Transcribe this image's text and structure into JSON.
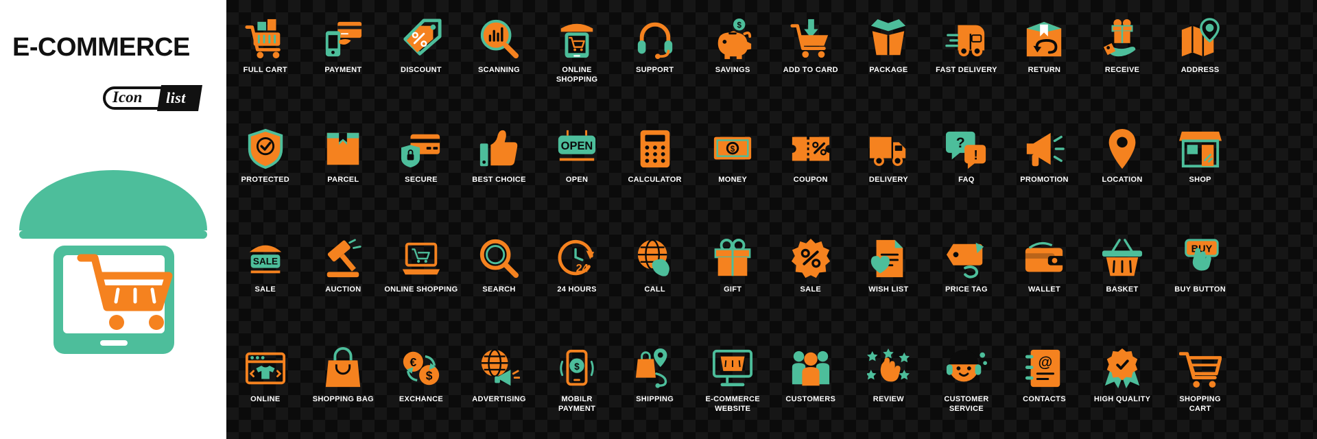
{
  "left": {
    "title": "E-COMMERCE",
    "logo": {
      "word_icon": "Icon",
      "word_list": "list"
    },
    "hero_icon_name": "online-store-mobile-cart-illustration"
  },
  "colors": {
    "orange": "#F5821F",
    "teal": "#4DBE9B",
    "dark_bg": "#0b0b0b",
    "checker": "#161616",
    "label": "#FFFFFF",
    "title": "#111111"
  },
  "grid": {
    "columns": 14,
    "rows": 4,
    "icons": [
      {
        "label": "FULL CART",
        "icon": "full-cart-icon"
      },
      {
        "label": "PAYMENT",
        "icon": "payment-card-hand-icon"
      },
      {
        "label": "DISCOUNT",
        "icon": "discount-tag-icon"
      },
      {
        "label": "SCANNING",
        "icon": "magnifier-chart-icon"
      },
      {
        "label": "ONLINE\nSHOPPING",
        "icon": "online-shopping-mobile-store-icon"
      },
      {
        "label": "SUPPORT",
        "icon": "headset-support-icon"
      },
      {
        "label": "SAVINGS",
        "icon": "piggy-bank-icon"
      },
      {
        "label": "ADD TO CARD",
        "icon": "add-to-cart-arrow-icon"
      },
      {
        "label": "PACKAGE",
        "icon": "open-box-package-icon"
      },
      {
        "label": "FAST DELIVERY",
        "icon": "fast-delivery-truck-icon"
      },
      {
        "label": "RETURN",
        "icon": "return-box-arrow-icon"
      },
      {
        "label": "RECEIVE",
        "icon": "receive-gift-hand-icon"
      },
      {
        "label": "ADDRESS",
        "icon": "map-pin-address-icon"
      },
      {
        "label": "PROTECTED",
        "icon": "shield-check-icon"
      },
      {
        "label": "PARCEL",
        "icon": "parcel-box-icon"
      },
      {
        "label": "SECURE",
        "icon": "secure-card-lock-icon"
      },
      {
        "label": "BEST CHOICE",
        "icon": "thumbs-up-icon"
      },
      {
        "label": "OPEN",
        "icon": "open-sign-icon"
      },
      {
        "label": "CALCULATOR",
        "icon": "calculator-icon"
      },
      {
        "label": "MONEY",
        "icon": "banknote-money-icon"
      },
      {
        "label": "COUPON",
        "icon": "coupon-percent-icon"
      },
      {
        "label": "DELIVERY",
        "icon": "delivery-van-icon"
      },
      {
        "label": "FAQ",
        "icon": "faq-question-bubble-icon"
      },
      {
        "label": "PROMOTION",
        "icon": "megaphone-promotion-icon"
      },
      {
        "label": "LOCATION",
        "icon": "location-pin-icon"
      },
      {
        "label": "SHOP",
        "icon": "shop-storefront-icon"
      },
      {
        "label": "SALE",
        "icon": "sale-tag-icon"
      },
      {
        "label": "AUCTION",
        "icon": "auction-gavel-icon"
      },
      {
        "label": "ONLINE SHOPPING",
        "icon": "laptop-cart-icon"
      },
      {
        "label": "SEARCH",
        "icon": "search-magnifier-icon"
      },
      {
        "label": "24 HOURS",
        "icon": "24-hours-clock-icon"
      },
      {
        "label": "CALL",
        "icon": "global-call-icon"
      },
      {
        "label": "GIFT",
        "icon": "gift-box-icon"
      },
      {
        "label": "SALE",
        "icon": "sale-percent-badge-icon"
      },
      {
        "label": "WISH LIST",
        "icon": "wish-list-heart-document-icon"
      },
      {
        "label": "PRICE TAG",
        "icon": "price-tag-icon"
      },
      {
        "label": "WALLET",
        "icon": "wallet-icon"
      },
      {
        "label": "BASKET",
        "icon": "shopping-basket-icon"
      },
      {
        "label": "BUY BUTTON",
        "icon": "buy-button-click-icon"
      },
      {
        "label": "ONLINE",
        "icon": "online-browser-tshirt-icon"
      },
      {
        "label": "SHOPPING BAG",
        "icon": "shopping-bag-icon"
      },
      {
        "label": "EXCHANCE",
        "icon": "currency-exchange-icon"
      },
      {
        "label": "ADVERTISING",
        "icon": "advertising-globe-megaphone-icon"
      },
      {
        "label": "MOBILR\nPAYMENT",
        "icon": "mobile-payment-icon"
      },
      {
        "label": "SHIPPING",
        "icon": "shipping-bag-route-icon"
      },
      {
        "label": "E-COMMERCE\nWEBSITE",
        "icon": "ecommerce-website-monitor-icon"
      },
      {
        "label": "CUSTOMERS",
        "icon": "customers-group-icon"
      },
      {
        "label": "REVIEW",
        "icon": "review-stars-click-icon"
      },
      {
        "label": "CUSTOMER\nSERVICE",
        "icon": "customer-service-agent-icon"
      },
      {
        "label": "CONTACTS",
        "icon": "contacts-book-icon"
      },
      {
        "label": "HIGH QUALITY",
        "icon": "high-quality-badge-icon"
      },
      {
        "label": "SHOPPING\nCART",
        "icon": "shopping-cart-icon"
      }
    ]
  }
}
